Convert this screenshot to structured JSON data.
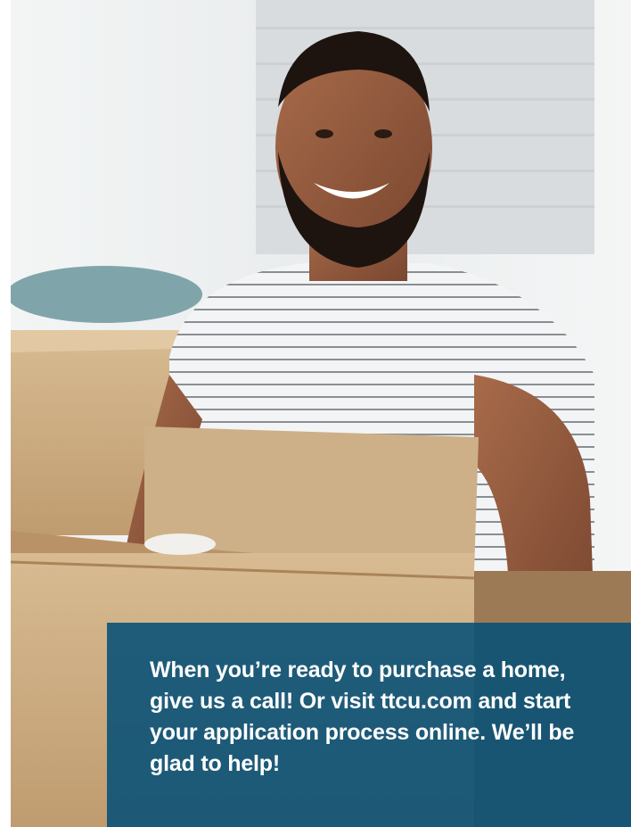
{
  "colors": {
    "panel": "#065078",
    "panel_text": "#ffffff",
    "cardboard": "#c9a97e"
  },
  "cta": {
    "text": "When you’re ready to purchase a home, give us a call! Or visit ttcu.com and start your application process online. We’ll be glad to help!"
  }
}
